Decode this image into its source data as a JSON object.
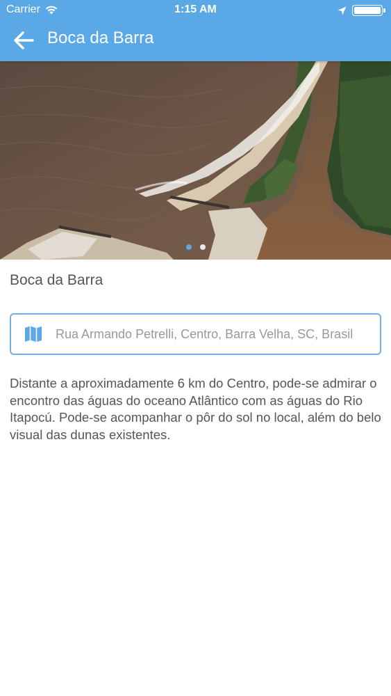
{
  "status_bar": {
    "carrier": "Carrier",
    "time": "1:15 AM"
  },
  "nav": {
    "title": "Boca da Barra",
    "back_icon": "arrow-left-icon"
  },
  "gallery": {
    "image_subject": "aerial view of river mouth meeting the ocean",
    "page_count": 2,
    "active_page": 1
  },
  "place": {
    "title": "Boca da Barra",
    "address": "Rua Armando Petrelli, Centro, Barra Velha, SC, Brasil",
    "address_icon": "map-icon",
    "description": "Distante a aproximadamente 6 km do Centro, pode-se admirar o encontro das águas do oceano Atlântico com as águas do Rio Itapocú. Pode-se acompanhar o pôr do sol no local, além do belo visual das dunas existentes."
  },
  "colors": {
    "primary": "#5aa9e6",
    "border": "#6db1e9",
    "text": "#555555",
    "placeholder": "#999999"
  }
}
